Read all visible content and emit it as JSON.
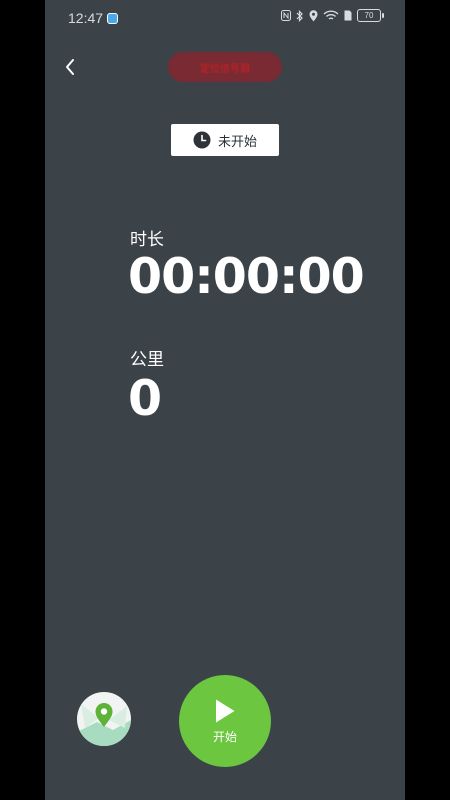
{
  "status_bar": {
    "time": "12:47",
    "battery": "70"
  },
  "header": {
    "gps_label": "定位信号弱"
  },
  "session": {
    "state_label": "未开始"
  },
  "metrics": {
    "duration_label": "时长",
    "duration_value": "00:00:00",
    "distance_label": "公里",
    "distance_value": "0"
  },
  "controls": {
    "start_label": "开始"
  },
  "colors": {
    "background": "#3b4349",
    "accent_green": "#6cc63f",
    "alert_red": "#d21f1f"
  }
}
